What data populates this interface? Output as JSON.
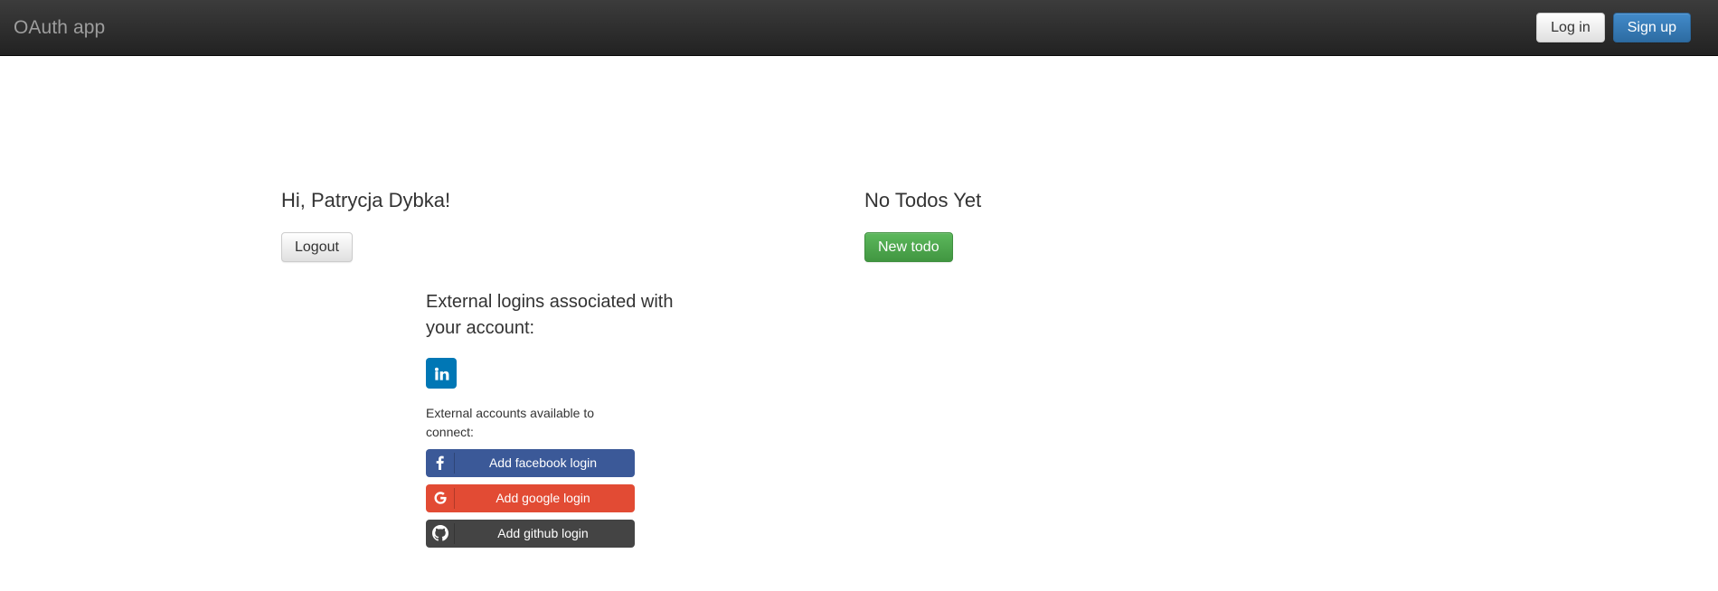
{
  "navbar": {
    "brand": "OAuth app",
    "login_label": "Log in",
    "signup_label": "Sign up"
  },
  "main": {
    "greeting": "Hi, Patrycja Dybka!",
    "logout_label": "Logout",
    "external": {
      "title": "External logins associated with your account:",
      "linked": [
        {
          "name": "linkedin",
          "icon": "linkedin-icon",
          "color": "#0077b5"
        }
      ],
      "available_label": "External accounts available to connect:",
      "buttons": [
        {
          "icon": "facebook-icon",
          "label": "Add facebook login",
          "color": "#3b5998"
        },
        {
          "icon": "google-icon",
          "label": "Add google login",
          "color": "#e24b34"
        },
        {
          "icon": "github-icon",
          "label": "Add github login",
          "color": "#444444"
        }
      ]
    }
  },
  "todos": {
    "title": "No Todos Yet",
    "new_todo_label": "New todo"
  },
  "colors": {
    "navbar_top": "#3c3c3c",
    "navbar_bottom": "#222222",
    "brand_text": "#9d9d9d",
    "primary": "#428bca",
    "success": "#5cb85c",
    "body_text": "#333333"
  }
}
